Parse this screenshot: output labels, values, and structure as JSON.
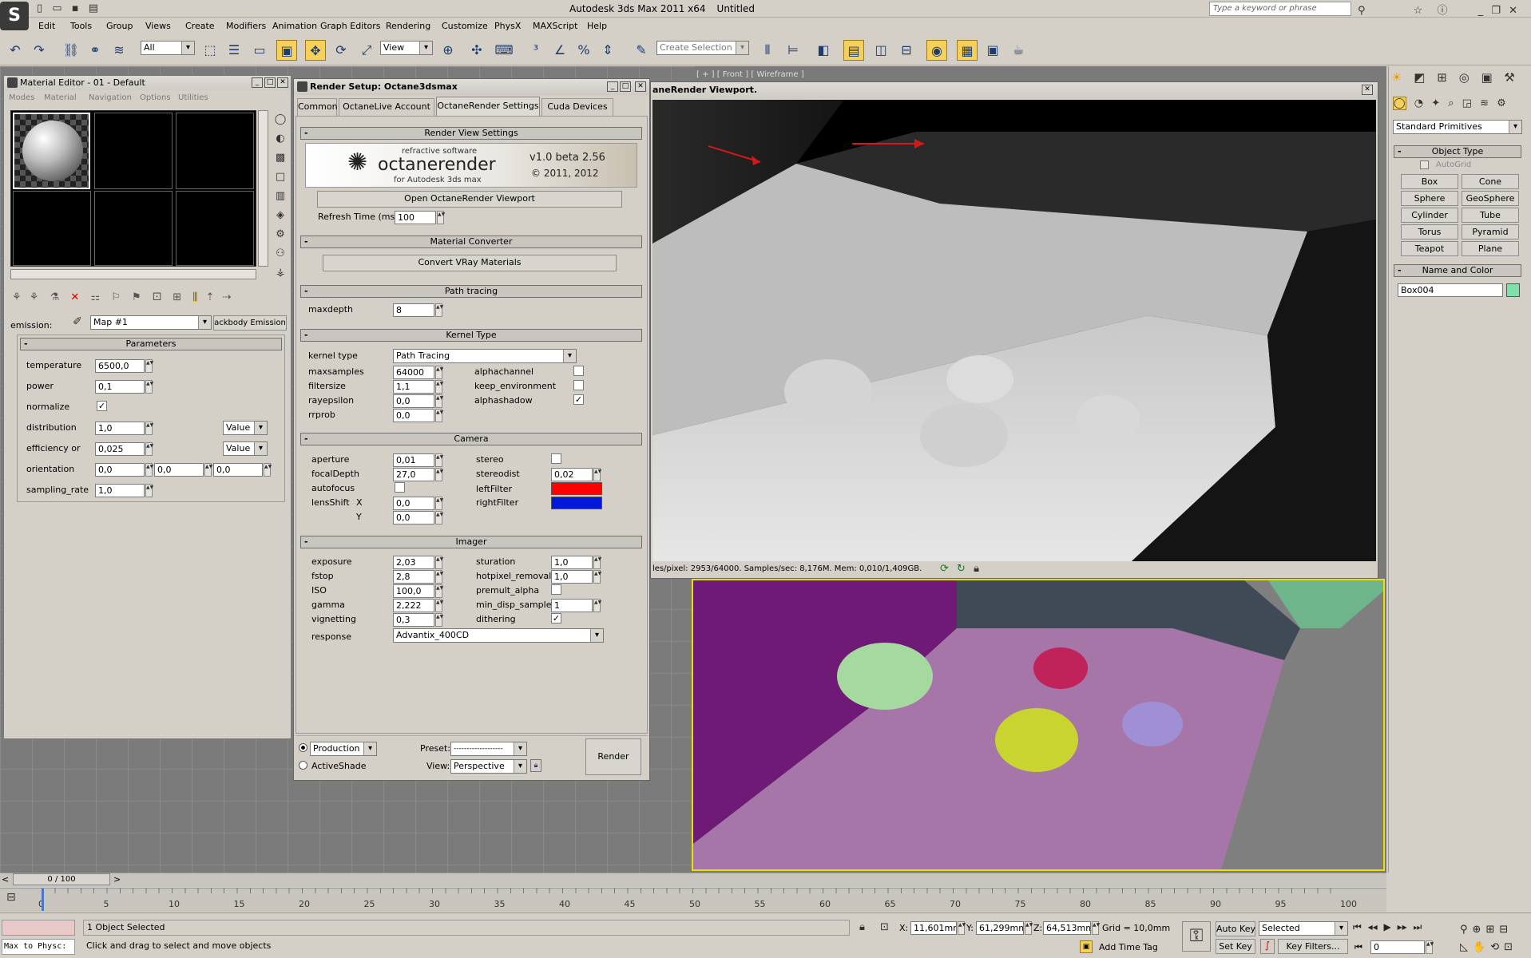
{
  "app": {
    "title": "Autodesk 3ds Max  2011 x64",
    "file": "Untitled",
    "search_placeholder": "Type a keyword or phrase",
    "menu": [
      "Edit",
      "Tools",
      "Group",
      "Views",
      "Create",
      "Modifiers",
      "Animation",
      "Graph Editors",
      "Rendering",
      "Customize",
      "PhysX",
      "MAXScript",
      "Help"
    ]
  },
  "toolbar": {
    "filter": "All",
    "ref_coord": "View",
    "selection_set": "Create Selection Se"
  },
  "viewport_labels": {
    "front": "[ + ] [ Front ] [ Wireframe ]"
  },
  "material_editor": {
    "title": "Material Editor - 01 - Default",
    "menu": [
      "Modes",
      "Material",
      "Navigation",
      "Options",
      "Utilities"
    ],
    "emission_label": "emission:",
    "map_name": "Map #1",
    "map_type": "ackbody Emission",
    "rollout": "Parameters",
    "params": {
      "temperature": {
        "label": "temperature",
        "value": "6500,0"
      },
      "power": {
        "label": "power",
        "value": "0,1"
      },
      "normalize": {
        "label": "normalize",
        "checked": "✓"
      },
      "distribution": {
        "label": "distribution",
        "value": "1,0",
        "mode": "Value"
      },
      "efficiency": {
        "label": "efficiency or",
        "value": "0,025",
        "mode": "Value"
      },
      "orientation": {
        "label": "orientation",
        "x": "0,0",
        "y": "0,0",
        "z": "0,0"
      },
      "sampling_rate": {
        "label": "sampling_rate",
        "value": "1,0"
      }
    }
  },
  "render_setup": {
    "title": "Render Setup: Octane3dsmax",
    "tabs": [
      "Common",
      "OctaneLive Account",
      "OctaneRender Settings",
      "Cuda Devices"
    ],
    "render_view": {
      "header": "Render View Settings",
      "banner_company": "refractive software",
      "banner_product": "octanerender",
      "banner_sub": "for Autodesk 3ds max",
      "banner_version": "v1.0 beta 2.56",
      "banner_copyright": "© 2011, 2012",
      "open_button": "Open OctaneRender Viewport",
      "refresh_label": "Refresh Time (ms)",
      "refresh_value": "100"
    },
    "material_converter": {
      "header": "Material Converter",
      "button": "Convert VRay Materials"
    },
    "path_tracing": {
      "header": "Path tracing",
      "maxdepth_label": "maxdepth",
      "maxdepth": "8"
    },
    "kernel": {
      "header": "Kernel Type",
      "kernel_label": "kernel type",
      "kernel_value": "Path Tracing",
      "maxsamples_label": "maxsamples",
      "maxsamples": "64000",
      "filtersize_label": "filtersize",
      "filtersize": "1,1",
      "rayepsilon_label": "rayepsilon",
      "rayepsilon": "0,0",
      "rrprob_label": "rrprob",
      "rrprob": "0,0",
      "alphachannel": "alphachannel",
      "keep_environment": "keep_environment",
      "alphashadow": "alphashadow",
      "check": "✓"
    },
    "camera": {
      "header": "Camera",
      "aperture_label": "aperture",
      "aperture": "0,01",
      "focal_label": "focalDepth",
      "focal": "27,0",
      "autofocus": "autofocus",
      "lensshift_label": "lensShift",
      "x_label": "X",
      "x": "0,0",
      "y_label": "Y",
      "y": "0,0",
      "stereo": "stereo",
      "stereodist_label": "stereodist",
      "stereodist": "0,02",
      "leftfilter": "leftFilter",
      "rightfilter": "rightFilter",
      "left_color": "#ff0000",
      "right_color": "#0018d8"
    },
    "imager": {
      "header": "Imager",
      "exposure_label": "exposure",
      "exposure": "2,03",
      "fstop_label": "fstop",
      "fstop": "2,8",
      "iso_label": "ISO",
      "iso": "100,0",
      "gamma_label": "gamma",
      "gamma": "2,222",
      "vignetting_label": "vignetting",
      "vignetting": "0,3",
      "response_label": "response",
      "response": "Advantix_400CD",
      "sturation_label": "sturation",
      "sturation": "1,0",
      "hotpixel_label": "hotpixel_removal",
      "hotpixel": "1,0",
      "premult_label": "premult_alpha",
      "mindisp_label": "min_disp_samples",
      "mindisp": "1",
      "dithering_label": "dithering",
      "check": "✓"
    },
    "bottom": {
      "production": "Production",
      "activeshade": "ActiveShade",
      "preset_label": "Preset:",
      "preset": "-------------------",
      "view_label": "View:",
      "view": "Perspective",
      "render_button": "Render"
    }
  },
  "octane_viewport": {
    "title": "aneRender Viewport.",
    "status": "les/pixel: 2953/64000. Samples/sec: 8,176M. Mem: 0,010/1,409GB."
  },
  "command_panel": {
    "category": "Standard Primitives",
    "object_type_header": "Object Type",
    "autogrid": "AutoGrid",
    "buttons": [
      "Box",
      "Cone",
      "Sphere",
      "GeoSphere",
      "Cylinder",
      "Tube",
      "Torus",
      "Pyramid",
      "Teapot",
      "Plane"
    ],
    "name_color_header": "Name and Color",
    "object_name": "Box004",
    "object_color": "#7fe0a8"
  },
  "timeline": {
    "frame_display": "0 / 100",
    "ticks": [
      "0",
      "5",
      "10",
      "15",
      "20",
      "25",
      "30",
      "35",
      "40",
      "45",
      "50",
      "55",
      "60",
      "65",
      "70",
      "75",
      "80",
      "85",
      "90",
      "95",
      "100"
    ]
  },
  "status": {
    "maxscript": "Max to Physc:",
    "selected_count": "1 Object Selected",
    "prompt": "Click and drag to select and move objects",
    "x_label": "X:",
    "x": "11,601mm",
    "y_label": "Y:",
    "y": "61,299mm",
    "z_label": "Z:",
    "z": "64,513mm",
    "grid": "Grid = 10,0mm",
    "add_time_tag": "Add Time Tag",
    "auto_key": "Auto Key",
    "set_key": "Set Key",
    "key_mode": "Selected",
    "key_filters": "Key Filters...",
    "current_frame": "0"
  }
}
